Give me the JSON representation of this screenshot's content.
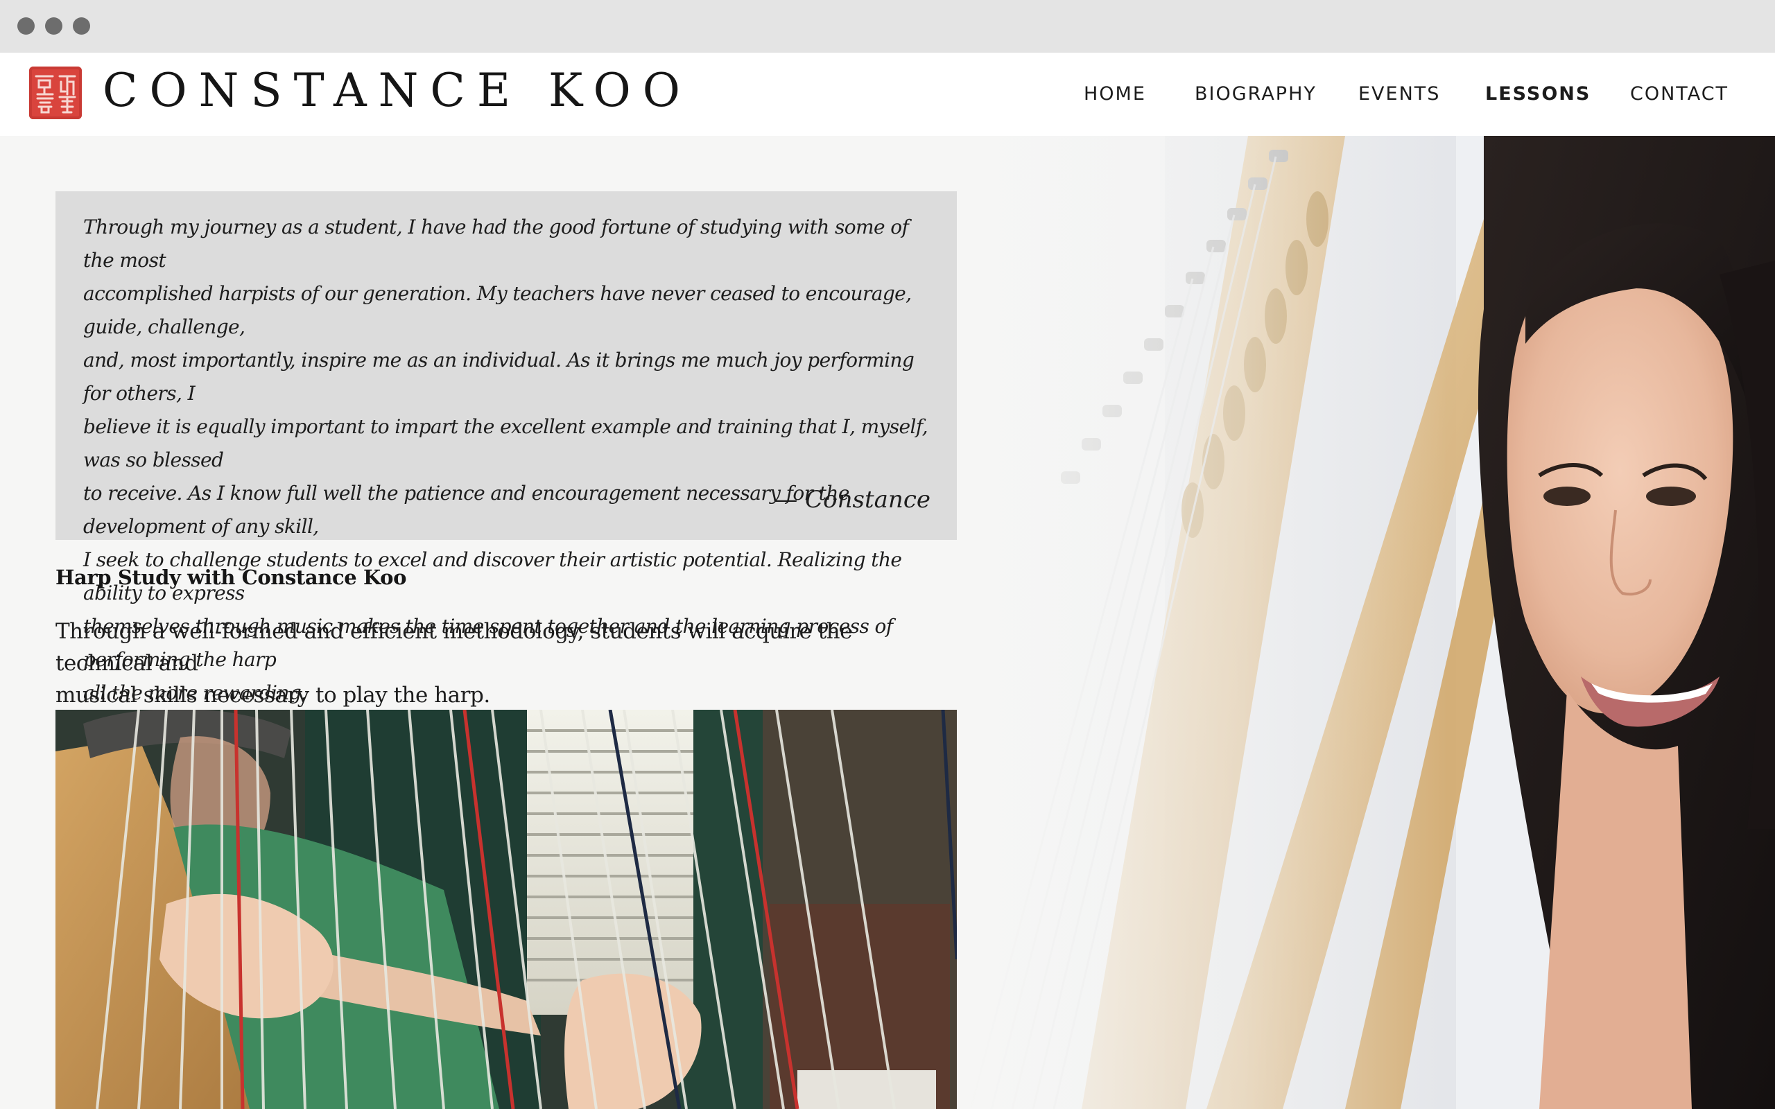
{
  "site": {
    "title": "CONSTANCE KOO",
    "seal_text": "凱珂善",
    "seal_color": "#d9443d"
  },
  "nav": {
    "items": [
      {
        "label": "HOME",
        "active": false
      },
      {
        "label": "BIOGRAPHY",
        "active": false
      },
      {
        "label": "EVENTS",
        "active": false
      },
      {
        "label": "LESSONS",
        "active": true
      },
      {
        "label": "CONTACT",
        "active": false
      }
    ]
  },
  "quote": {
    "lines": [
      "Through my journey as a student, I have had the good fortune of studying with some of the most",
      "accomplished harpists of our generation. My teachers have never ceased to encourage, guide, challenge,",
      "and, most importantly, inspire me as an individual. As it brings me much joy performing for others, I",
      "believe it is equally important to impart the excellent example and training that I, myself, was so blessed",
      "to receive. As I know full well the patience and encouragement necessary for the development of any skill,",
      "I seek to challenge students to excel and discover their artistic potential. Realizing the ability to express",
      "themselves through music makes the time spent together and the learning process of performing the harp",
      "all the more rewarding."
    ],
    "attribution": "— Constance"
  },
  "section": {
    "heading": "Harp Study with Constance Koo",
    "body_lines": [
      "Through a well-formed and efficient methodology, students will acquire the technical and",
      "musical skills necessary to play the harp."
    ]
  },
  "images": {
    "portrait": "portrait-photo",
    "student": "student-harp-photo"
  }
}
